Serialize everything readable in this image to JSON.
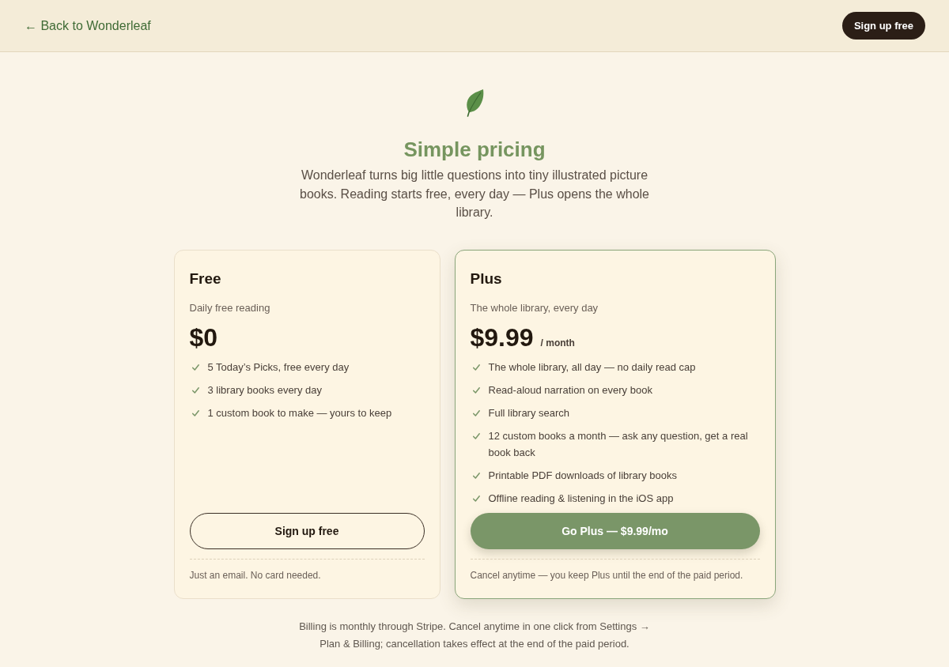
{
  "header": {
    "back_link": "← Back to Wonderleaf",
    "signup_button": "Sign up free"
  },
  "hero": {
    "title": "Simple pricing",
    "subtitle": "Wonderleaf turns big little questions into tiny illustrated picture books. Reading starts free, every day — Plus opens the whole library."
  },
  "plans": [
    {
      "name": "Free",
      "tagline": "Daily free reading",
      "price": "$0",
      "featured": false,
      "features": [
        "5 Today’s Picks, free every day",
        "3 library books every day",
        "1 custom book to make — yours to keep"
      ],
      "button": "Sign up free",
      "note": "Just an email. No card needed."
    },
    {
      "name": "Plus",
      "tagline": "The whole library, every day",
      "price": "$9.99",
      "period": "/ month",
      "featured": true,
      "features": [
        "The whole library, all day — no daily read cap",
        "Read-aloud narration on every book",
        "Full library search",
        "12 custom books a month — ask any question, get a real book back",
        "Printable PDF downloads of library books",
        "Offline reading & listening in the iOS app"
      ],
      "button": "Go Plus — $9.99/mo",
      "note": "Cancel anytime — you keep Plus until the end of the paid period."
    }
  ],
  "footer_note": "Billing is monthly through Stripe. Cancel anytime in one click from Settings → Plan & Billing; cancellation takes effect at the end of the paid period."
}
